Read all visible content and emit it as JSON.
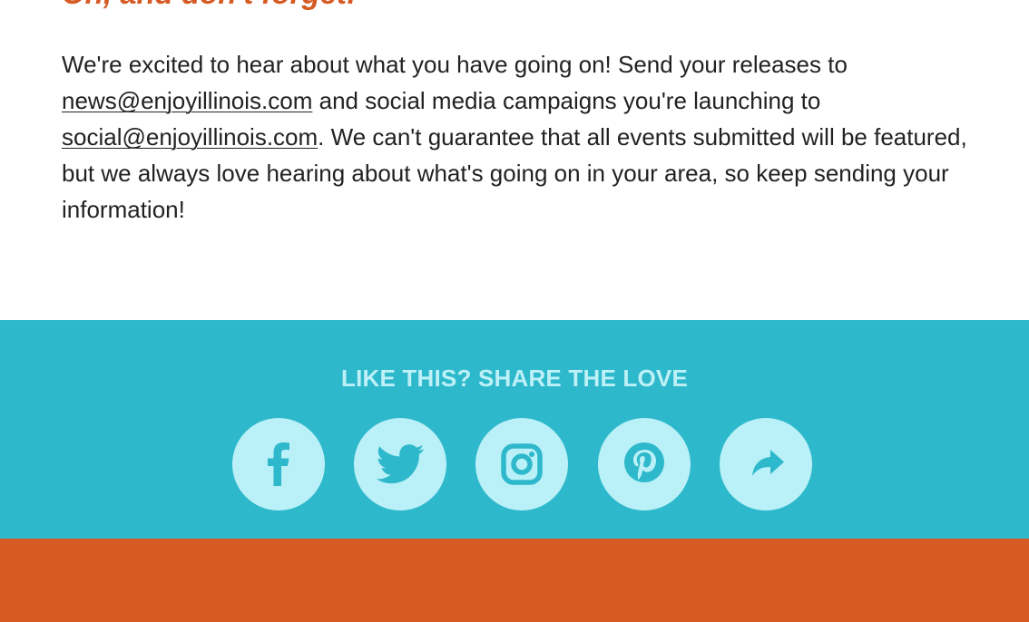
{
  "content": {
    "heading": "Oh, and don't forget!",
    "paragraph": {
      "text_1": "We're excited to hear about what you have going on! Send your releases to ",
      "link_news": "news@enjoyillinois.com",
      "text_2": " and social media campaigns you're launching to ",
      "link_social": "social@enjoyillinois.com",
      "text_3": ". We can't guarantee that all events submitted will be featured, but we always love hearing about what's going on in your area, so keep sending your information!"
    }
  },
  "share": {
    "title": "LIKE THIS? SHARE THE LOVE",
    "buttons": [
      {
        "icon": "facebook-icon"
      },
      {
        "icon": "twitter-icon"
      },
      {
        "icon": "instagram-icon"
      },
      {
        "icon": "pinterest-icon"
      },
      {
        "icon": "share-arrow-icon"
      }
    ]
  },
  "colors": {
    "accent_orange": "#d55a23",
    "share_band": "#2eb8cb",
    "icon_circle": "#baf0f7",
    "icon_glyph": "#2eb8cb",
    "body_text": "#222222"
  }
}
